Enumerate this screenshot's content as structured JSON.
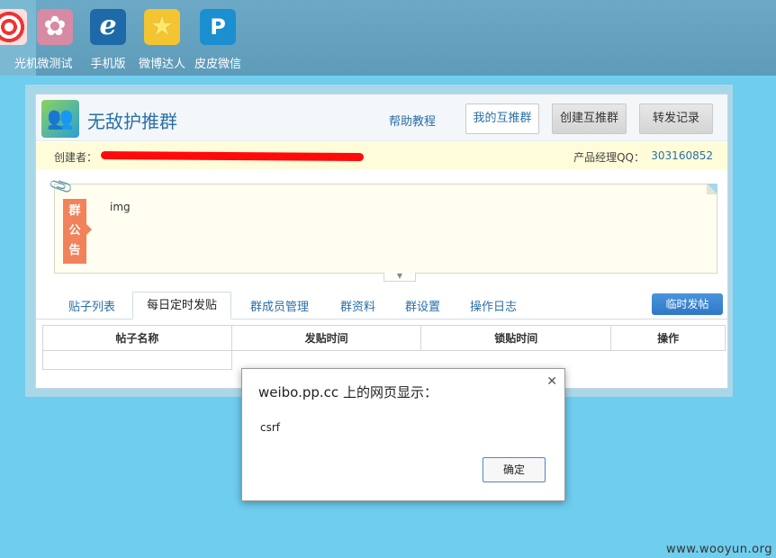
{
  "topbar": {
    "apps": [
      {
        "label": "光机",
        "icon": "target-icon"
      },
      {
        "label": "微测试",
        "icon": "clover-icon"
      },
      {
        "label": "手机版",
        "icon": "phone-app-icon"
      },
      {
        "label": "微博达人",
        "icon": "star-icon"
      },
      {
        "label": "皮皮微信",
        "icon": "chat-bubble-icon"
      }
    ]
  },
  "header": {
    "title": "无敌护推群",
    "help_link": "帮助教程",
    "my_groups": "我的互推群",
    "create_group": "创建互推群",
    "repost_records": "转发记录"
  },
  "creator_bar": {
    "creator_label": "创建者：",
    "pm_qq_label": "产品经理QQ：",
    "pm_qq_value": "303160852"
  },
  "notice": {
    "tag": [
      "群",
      "公",
      "告"
    ],
    "text": "img"
  },
  "tabs": [
    {
      "label": "贴子列表"
    },
    {
      "label": "每日定时发贴",
      "active": true
    },
    {
      "label": "群成员管理"
    },
    {
      "label": "群资料"
    },
    {
      "label": "群设置"
    },
    {
      "label": "操作日志"
    }
  ],
  "temp_post_button": "临时发帖",
  "table": {
    "headers": [
      "帖子名称",
      "发贴时间",
      "锁贴时间",
      "操作"
    ]
  },
  "dialog": {
    "title": "weibo.pp.cc 上的网页显示：",
    "message": "csrf",
    "ok_label": "确定"
  },
  "watermark": "www.wooyun.org"
}
